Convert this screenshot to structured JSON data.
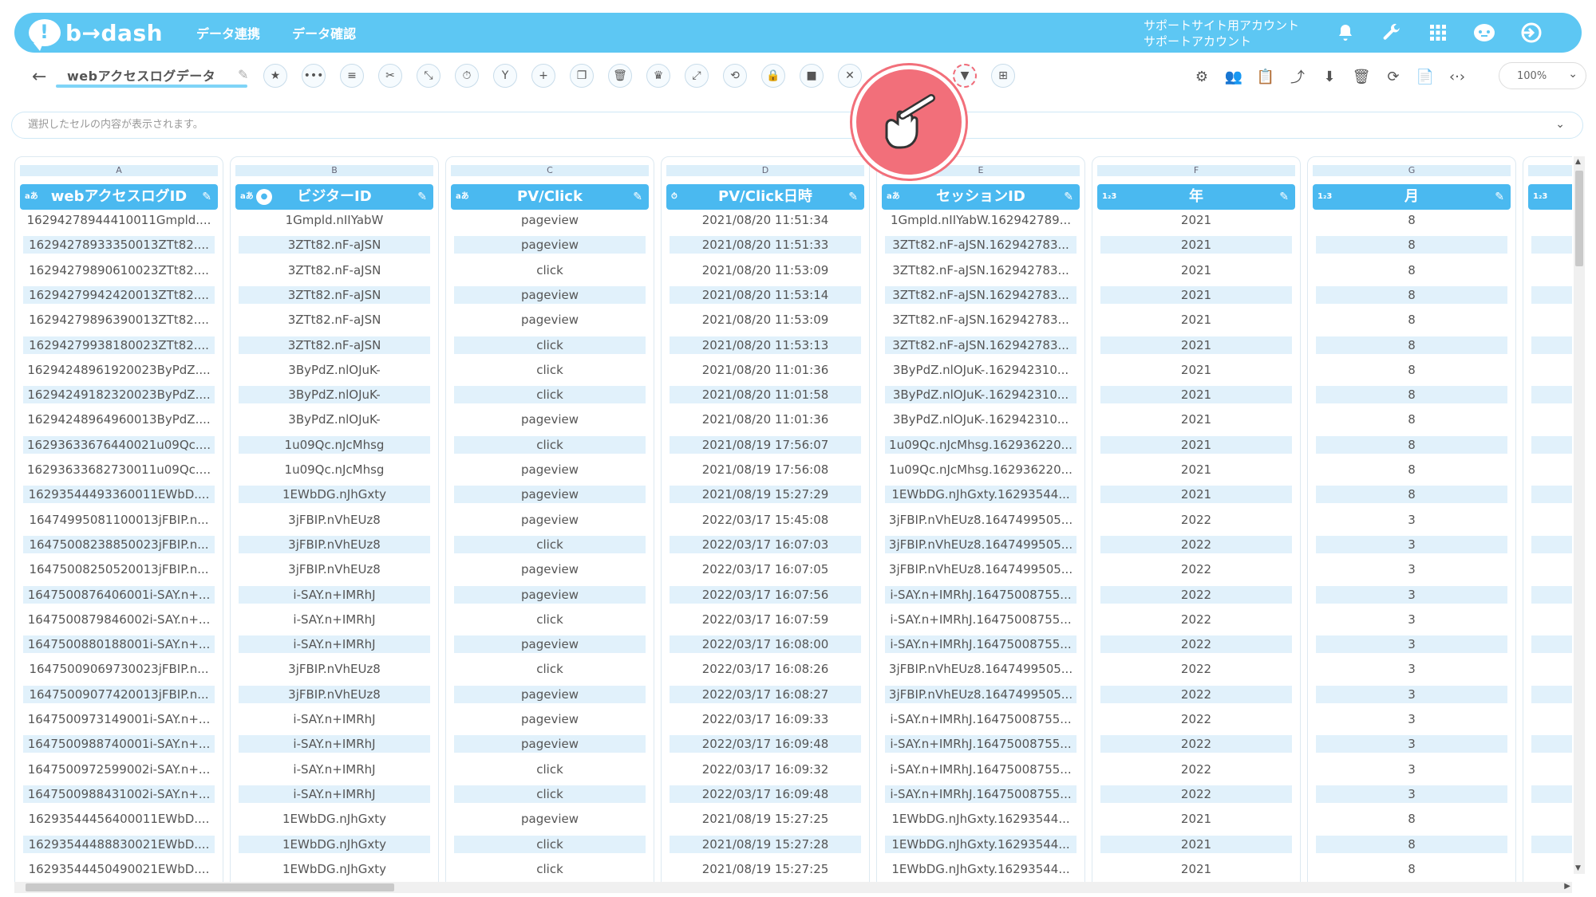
{
  "header": {
    "logo_text": "b→dash",
    "nav": [
      "データ連携",
      "データ確認"
    ],
    "account_line1": "サポートサイト用アカウント",
    "account_line2": "サポートアカウント"
  },
  "toolbar": {
    "title": "webアクセスログデータ",
    "zoom": "100%"
  },
  "cellbar": {
    "placeholder": "選択したセルの内容が表示されます。"
  },
  "grid": {
    "columns": [
      {
        "letter": "A",
        "name": "webアクセスログID",
        "type": "aあ"
      },
      {
        "letter": "B",
        "name": "ビジターID",
        "type": "aあ"
      },
      {
        "letter": "C",
        "name": "PV/Click",
        "type": "aあ"
      },
      {
        "letter": "D",
        "name": "PV/Click日時",
        "type": "⏱"
      },
      {
        "letter": "E",
        "name": "セッションID",
        "type": "aあ"
      },
      {
        "letter": "F",
        "name": "年",
        "type": "1₂3"
      },
      {
        "letter": "G",
        "name": "月",
        "type": "1₂3"
      },
      {
        "letter": "",
        "name": "",
        "type": "1₂3"
      }
    ],
    "rows": [
      [
        "16294278944410011Gmpld....",
        "1Gmpld.nIIYabW",
        "pageview",
        "2021/08/20 11:51:34",
        "1Gmpld.nIIYabW.162942789...",
        "2021",
        "8"
      ],
      [
        "16294278933350013ZTt82....",
        "3ZTt82.nF-aJSN",
        "pageview",
        "2021/08/20 11:51:33",
        "3ZTt82.nF-aJSN.162942783...",
        "2021",
        "8"
      ],
      [
        "16294279890610023ZTt82....",
        "3ZTt82.nF-aJSN",
        "click",
        "2021/08/20 11:53:09",
        "3ZTt82.nF-aJSN.162942783...",
        "2021",
        "8"
      ],
      [
        "16294279942420013ZTt82....",
        "3ZTt82.nF-aJSN",
        "pageview",
        "2021/08/20 11:53:14",
        "3ZTt82.nF-aJSN.162942783...",
        "2021",
        "8"
      ],
      [
        "16294279896390013ZTt82....",
        "3ZTt82.nF-aJSN",
        "pageview",
        "2021/08/20 11:53:09",
        "3ZTt82.nF-aJSN.162942783...",
        "2021",
        "8"
      ],
      [
        "16294279938180023ZTt82....",
        "3ZTt82.nF-aJSN",
        "click",
        "2021/08/20 11:53:13",
        "3ZTt82.nF-aJSN.162942783...",
        "2021",
        "8"
      ],
      [
        "16294248961920023ByPdZ....",
        "3ByPdZ.nlOJuK-",
        "click",
        "2021/08/20 11:01:36",
        "3ByPdZ.nlOJuK-.162942310...",
        "2021",
        "8"
      ],
      [
        "16294249182320023ByPdZ....",
        "3ByPdZ.nlOJuK-",
        "click",
        "2021/08/20 11:01:58",
        "3ByPdZ.nlOJuK-.162942310...",
        "2021",
        "8"
      ],
      [
        "16294248964960013ByPdZ....",
        "3ByPdZ.nlOJuK-",
        "pageview",
        "2021/08/20 11:01:36",
        "3ByPdZ.nlOJuK-.162942310...",
        "2021",
        "8"
      ],
      [
        "16293633676440021u09Qc....",
        "1u09Qc.nJcMhsg",
        "click",
        "2021/08/19 17:56:07",
        "1u09Qc.nJcMhsg.162936220...",
        "2021",
        "8"
      ],
      [
        "16293633682730011u09Qc....",
        "1u09Qc.nJcMhsg",
        "pageview",
        "2021/08/19 17:56:08",
        "1u09Qc.nJcMhsg.162936220...",
        "2021",
        "8"
      ],
      [
        "16293544493360011EWbD....",
        "1EWbDG.nJhGxty",
        "pageview",
        "2021/08/19 15:27:29",
        "1EWbDG.nJhGxty.16293544...",
        "2021",
        "8"
      ],
      [
        "16474995081100013jFBIP.n...",
        "3jFBIP.nVhEUz8",
        "pageview",
        "2022/03/17 15:45:08",
        "3jFBIP.nVhEUz8.1647499505...",
        "2022",
        "3"
      ],
      [
        "16475008238850023jFBIP.n...",
        "3jFBIP.nVhEUz8",
        "click",
        "2022/03/17 16:07:03",
        "3jFBIP.nVhEUz8.1647499505...",
        "2022",
        "3"
      ],
      [
        "16475008250520013jFBIP.n...",
        "3jFBIP.nVhEUz8",
        "pageview",
        "2022/03/17 16:07:05",
        "3jFBIP.nVhEUz8.1647499505...",
        "2022",
        "3"
      ],
      [
        "1647500876406001i-SAY.n+...",
        "i-SAY.n+IMRhJ",
        "pageview",
        "2022/03/17 16:07:56",
        "i-SAY.n+IMRhJ.16475008755...",
        "2022",
        "3"
      ],
      [
        "1647500879846002i-SAY.n+...",
        "i-SAY.n+IMRhJ",
        "click",
        "2022/03/17 16:07:59",
        "i-SAY.n+IMRhJ.16475008755...",
        "2022",
        "3"
      ],
      [
        "1647500880188001i-SAY.n+...",
        "i-SAY.n+IMRhJ",
        "pageview",
        "2022/03/17 16:08:00",
        "i-SAY.n+IMRhJ.16475008755...",
        "2022",
        "3"
      ],
      [
        "16475009069730023jFBIP.n...",
        "3jFBIP.nVhEUz8",
        "click",
        "2022/03/17 16:08:26",
        "3jFBIP.nVhEUz8.1647499505...",
        "2022",
        "3"
      ],
      [
        "16475009077420013jFBIP.n...",
        "3jFBIP.nVhEUz8",
        "pageview",
        "2022/03/17 16:08:27",
        "3jFBIP.nVhEUz8.1647499505...",
        "2022",
        "3"
      ],
      [
        "1647500973149001i-SAY.n+...",
        "i-SAY.n+IMRhJ",
        "pageview",
        "2022/03/17 16:09:33",
        "i-SAY.n+IMRhJ.16475008755...",
        "2022",
        "3"
      ],
      [
        "1647500988740001i-SAY.n+...",
        "i-SAY.n+IMRhJ",
        "pageview",
        "2022/03/17 16:09:48",
        "i-SAY.n+IMRhJ.16475008755...",
        "2022",
        "3"
      ],
      [
        "1647500972599002i-SAY.n+...",
        "i-SAY.n+IMRhJ",
        "click",
        "2022/03/17 16:09:32",
        "i-SAY.n+IMRhJ.16475008755...",
        "2022",
        "3"
      ],
      [
        "1647500988431002i-SAY.n+...",
        "i-SAY.n+IMRhJ",
        "click",
        "2022/03/17 16:09:48",
        "i-SAY.n+IMRhJ.16475008755...",
        "2022",
        "3"
      ],
      [
        "16293544456400011EWbD....",
        "1EWbDG.nJhGxty",
        "pageview",
        "2021/08/19 15:27:25",
        "1EWbDG.nJhGxty.16293544...",
        "2021",
        "8"
      ],
      [
        "16293544488830021EWbD....",
        "1EWbDG.nJhGxty",
        "click",
        "2021/08/19 15:27:28",
        "1EWbDG.nJhGxty.16293544...",
        "2021",
        "8"
      ],
      [
        "16293544450490021EWbD....",
        "1EWbDG.nJhGxty",
        "click",
        "2021/08/19 15:27:25",
        "1EWbDG.nJhGxty.16293544...",
        "2021",
        "8"
      ]
    ]
  }
}
